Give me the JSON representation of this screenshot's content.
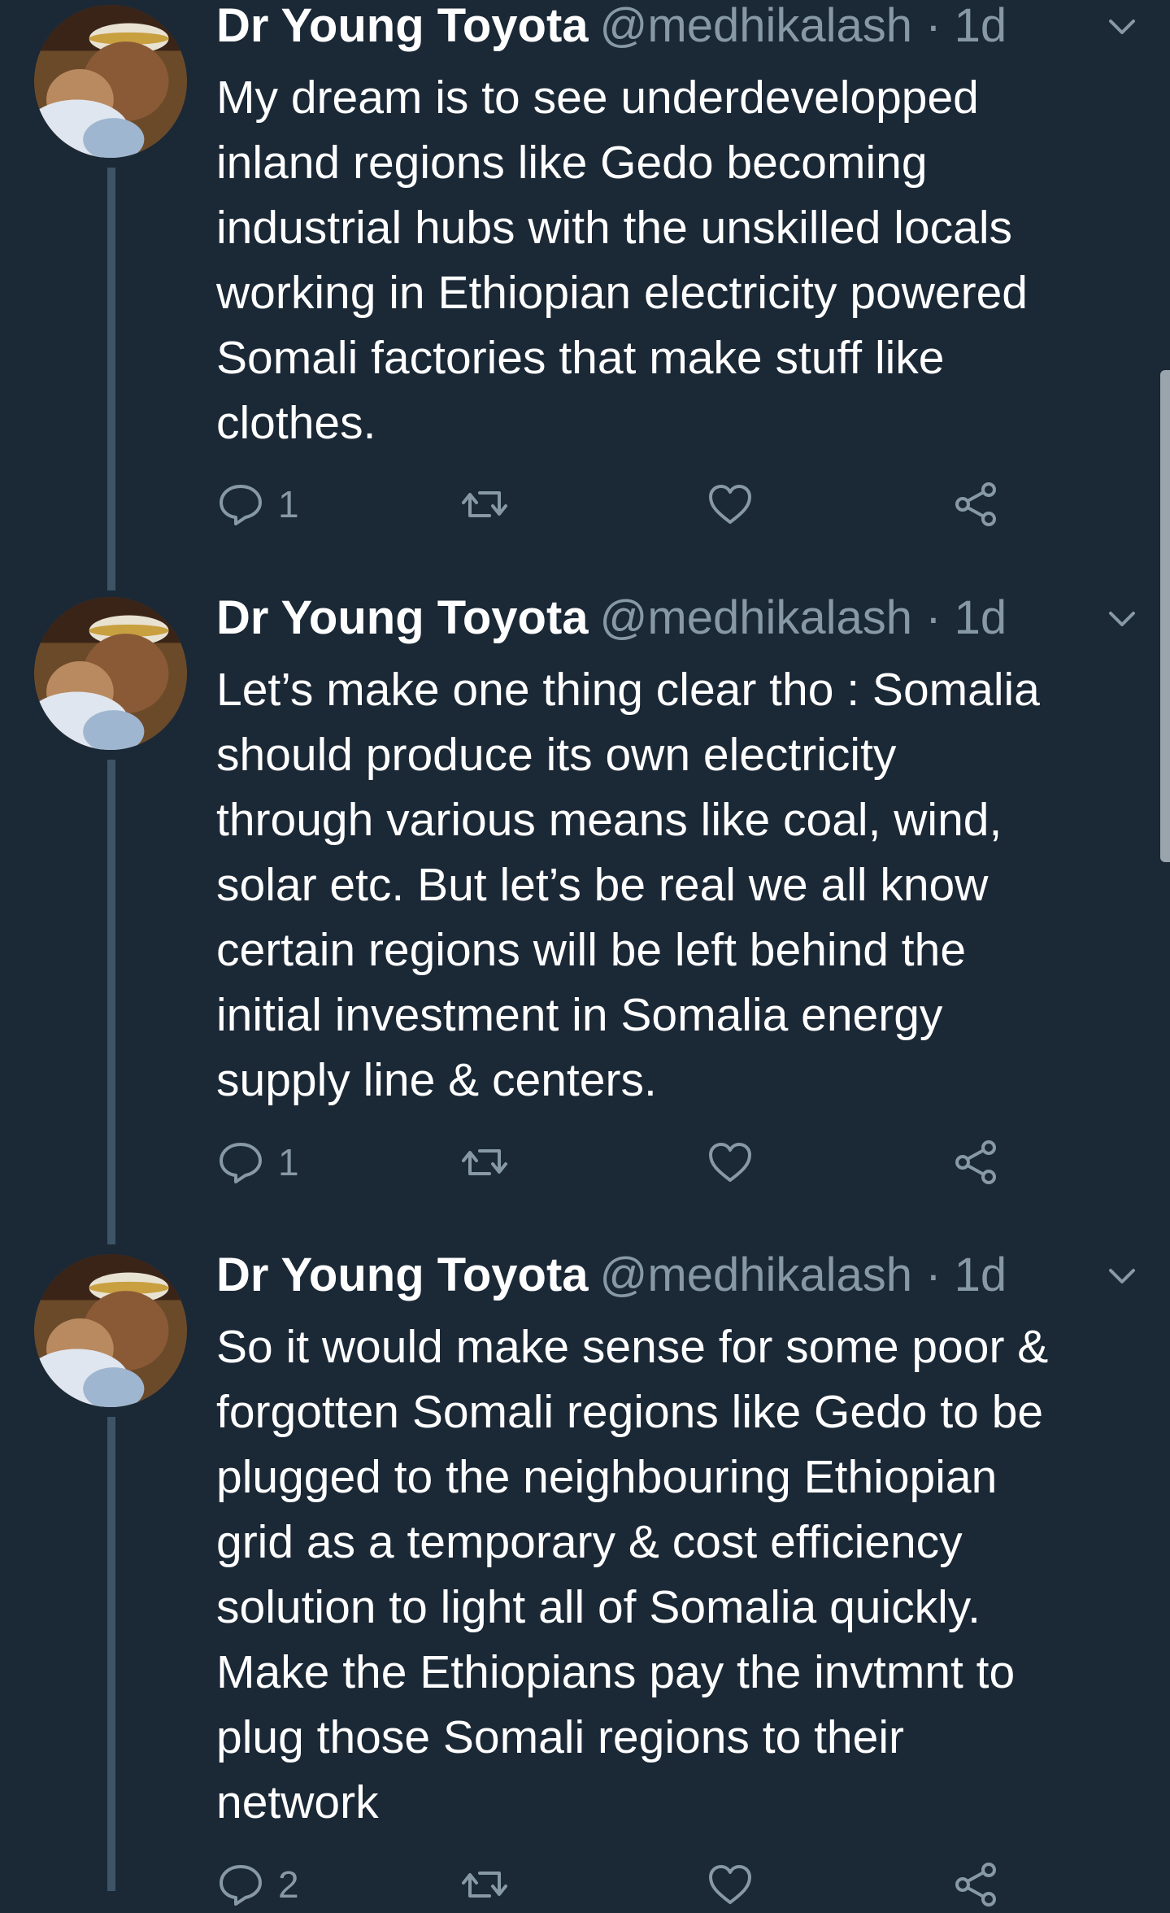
{
  "tweets": [
    {
      "display_name": "Dr Young Toyota",
      "handle": "@medhikalash",
      "separator": "·",
      "timestamp": "1d",
      "lines": [
        "My dream is to see underdevelopped",
        "inland regions like Gedo becoming",
        "industrial hubs with the unskilled locals",
        "working in Ethiopian electricity powered",
        "Somali factories that make stuff like",
        "clothes."
      ],
      "reply_count": "1",
      "retweet_count": "",
      "like_count": ""
    },
    {
      "display_name": "Dr Young Toyota",
      "handle": "@medhikalash",
      "separator": "·",
      "timestamp": "1d",
      "lines": [
        "Let’s make one thing clear tho : Somalia",
        "should produce its own electricity",
        "through various means like  coal, wind,",
        "solar etc. But let’s be real we all know",
        "certain regions will be left behind the",
        "initial investment in Somalia energy",
        "supply line & centers."
      ],
      "reply_count": "1",
      "retweet_count": "",
      "like_count": ""
    },
    {
      "display_name": "Dr Young Toyota",
      "handle": "@medhikalash",
      "separator": "·",
      "timestamp": "1d",
      "lines": [
        "So it would make sense for some poor &",
        "forgotten Somali regions like Gedo to be",
        "plugged to the neighbouring Ethiopian",
        "grid as a temporary & cost efficiency",
        "solution to light all of Somalia quickly.",
        "Make the Ethiopians pay the invtmnt to",
        "plug those Somali regions to their",
        "network"
      ],
      "reply_count": "2",
      "retweet_count": "",
      "like_count": ""
    }
  ],
  "icons": {
    "reply": "reply-icon",
    "retweet": "retweet-icon",
    "like": "like-icon",
    "share": "share-icon",
    "menu": "chevron-down-icon"
  },
  "colors": {
    "background": "#1b2836",
    "primary_text": "#ffffff",
    "secondary_text": "#8899a6",
    "thread_line": "#3d5466"
  }
}
